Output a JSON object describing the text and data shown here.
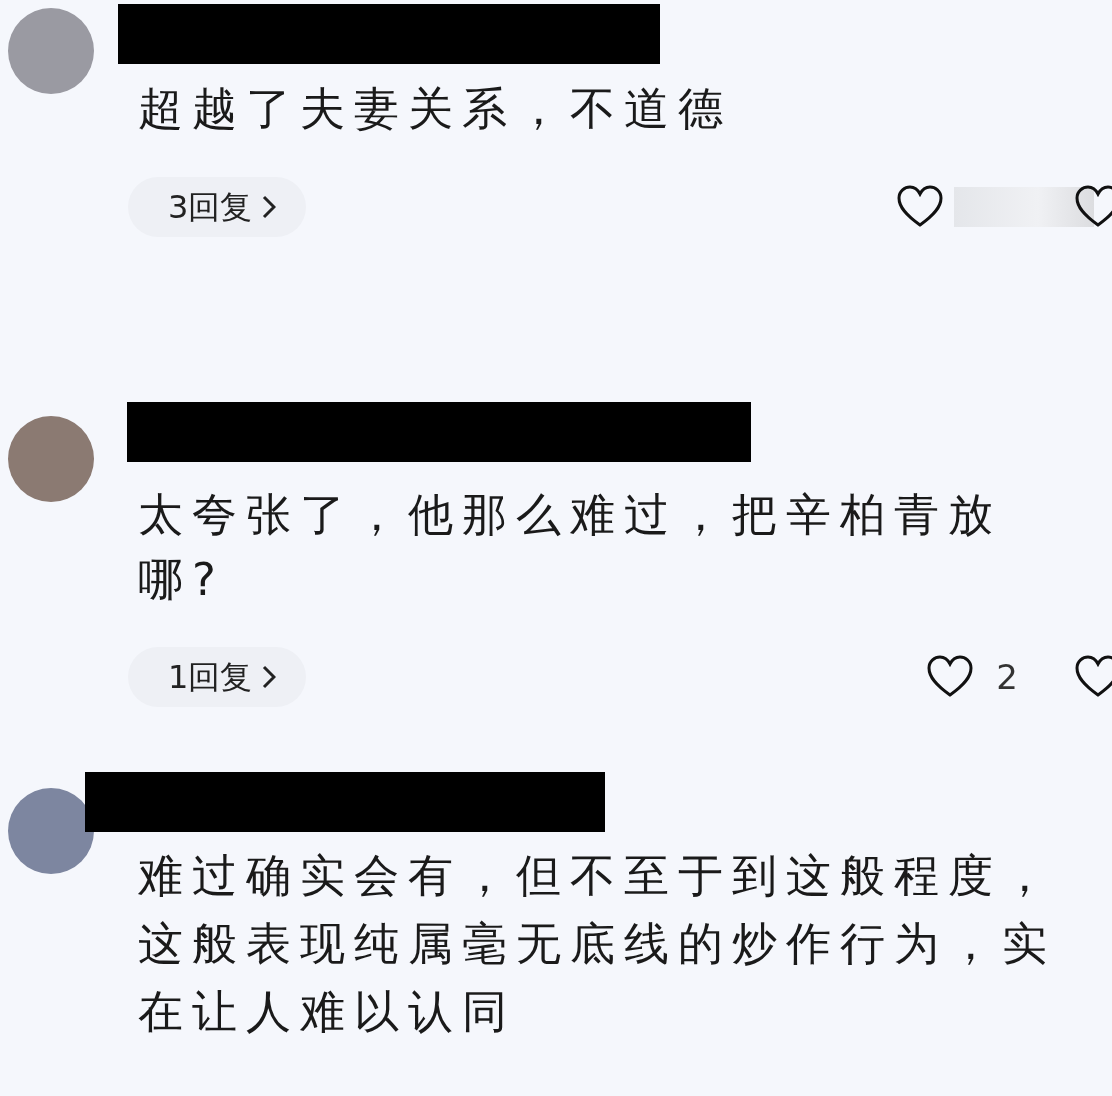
{
  "comments": [
    {
      "name_redacted": true,
      "lines": [
        "超越了夫妻关系，不道德"
      ],
      "actions": {
        "replies": "3回复",
        "like_count_obscured": true
      }
    },
    {
      "name_redacted": true,
      "lines": [
        "太夸张了，他那么难过，把辛柏青放",
        "哪?"
      ],
      "actions": {
        "replies": "1回复",
        "likes": "2"
      }
    },
    {
      "name_redacted": true,
      "lines": [
        "难过确实会有，但不至于到这般程度，",
        "这般表现纯属毫无底线的炒作行为，实",
        "在让人难以认同"
      ]
    }
  ]
}
